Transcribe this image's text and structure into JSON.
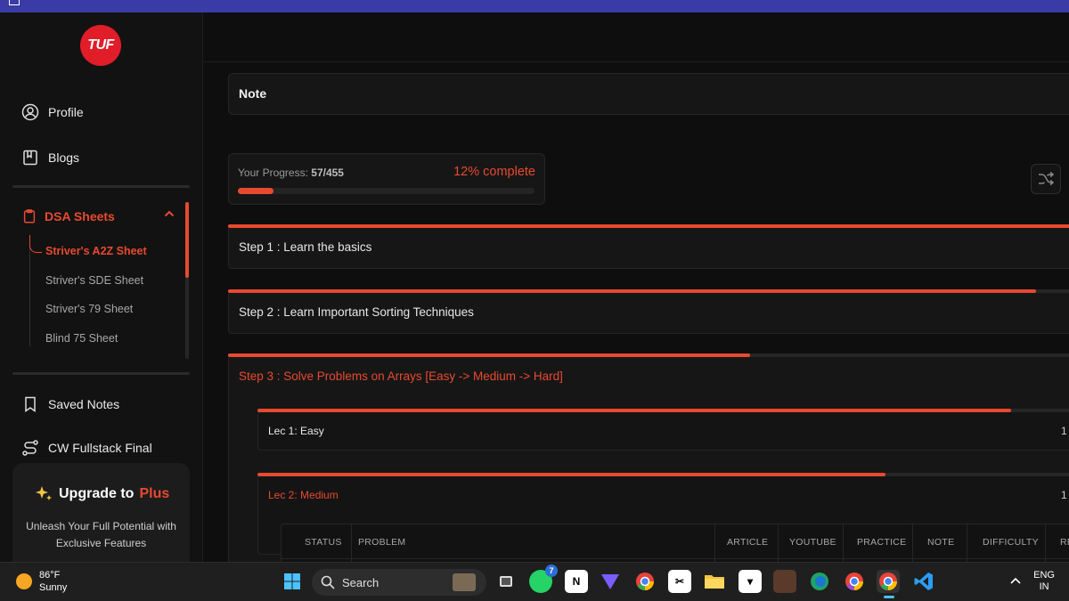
{
  "sidebar": {
    "logo_text": "TUF",
    "profile": "Profile",
    "blogs": "Blogs",
    "dsa_sheets": "DSA Sheets",
    "sheets": [
      "Striver's A2Z Sheet",
      "Striver's SDE Sheet",
      "Striver's 79 Sheet",
      "Blind 75 Sheet"
    ],
    "saved_notes": "Saved Notes",
    "cw_fullstack": "CW Fullstack Final",
    "upgrade": {
      "prefix": "Upgrade to",
      "plus": "Plus",
      "desc": "Unleash Your Full Potential with Exclusive Features"
    }
  },
  "main": {
    "note_title": "Note",
    "progress": {
      "label": "Your Progress:",
      "value": "57/455",
      "percent_text": "12% complete",
      "fraction": 0.12
    },
    "steps": [
      {
        "title": "Step 1 : Learn the basics",
        "progress": 1.0
      },
      {
        "title": "Step 2 : Learn Important Sorting Techniques",
        "progress": 0.945
      },
      {
        "title": "Step 3 : Solve Problems on Arrays [Easy -> Medium -> Hard]",
        "progress": 0.61
      }
    ],
    "lectures": [
      {
        "title": "Lec 1: Easy",
        "count": "1",
        "progress": 0.9
      },
      {
        "title": "Lec 2: Medium",
        "count": "1",
        "progress": 0.75
      }
    ],
    "table_headers": [
      "STATUS",
      "PROBLEM",
      "ARTICLE",
      "YOUTUBE",
      "PRACTICE",
      "NOTE",
      "DIFFICULTY",
      "RE"
    ]
  },
  "taskbar": {
    "temp": "86°F",
    "condition": "Sunny",
    "search": "Search",
    "whatsapp_badge": "7",
    "lang": "ENG",
    "region": "IN"
  },
  "colors": {
    "accent": "#e84a2f",
    "topbar": "#3b3ba8",
    "logo": "#e11d2a"
  }
}
